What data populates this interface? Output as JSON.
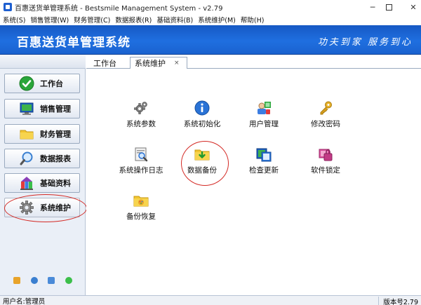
{
  "window": {
    "title": "百惠送货单管理系统 - Bestsmile Management System - v2.79",
    "minimize_glyph": "─",
    "close_glyph": "✕"
  },
  "menu": [
    "系统(S)",
    "销售管理(W)",
    "财务管理(C)",
    "数据报表(R)",
    "基础资料(B)",
    "系统维护(M)",
    "帮助(H)"
  ],
  "banner": {
    "app_name": "百惠送货单管理系统",
    "slogan": "功夫到家 服务到心"
  },
  "sidebar": {
    "items": [
      {
        "label": "工作台",
        "icon": "check-circle-icon"
      },
      {
        "label": "销售管理",
        "icon": "monitor-icon"
      },
      {
        "label": "财务管理",
        "icon": "folder-icon"
      },
      {
        "label": "数据报表",
        "icon": "magnifier-icon"
      },
      {
        "label": "基础资料",
        "icon": "building-blocks-icon"
      },
      {
        "label": "系统维护",
        "icon": "gear-icon"
      }
    ],
    "active_index": 5,
    "bottom_icons": [
      "note-icon",
      "clock-icon",
      "screen-icon",
      "refresh-icon"
    ]
  },
  "tabs": {
    "items": [
      {
        "label": "工作台"
      },
      {
        "label": "系统维护"
      }
    ],
    "active_index": 1,
    "close_glyph": "×"
  },
  "tools": [
    {
      "label": "系统参数",
      "icon": "gears-icon"
    },
    {
      "label": "系统初始化",
      "icon": "info-icon"
    },
    {
      "label": "用户管理",
      "icon": "users-icon"
    },
    {
      "label": "修改密码",
      "icon": "key-icon"
    },
    {
      "label": "系统操作日志",
      "icon": "log-search-icon"
    },
    {
      "label": "数据备份",
      "icon": "folder-download-icon"
    },
    {
      "label": "检查更新",
      "icon": "update-icon"
    },
    {
      "label": "软件锁定",
      "icon": "lock-icon"
    },
    {
      "label": "备份恢复",
      "icon": "folder-restore-icon"
    }
  ],
  "highlighted": [
    "数据备份",
    "系统维护"
  ],
  "status": {
    "user": "用户名:管理员",
    "version": "版本号2.79"
  },
  "colors": {
    "banner": "#1f6fe0",
    "highlight_ring": "#d42a25"
  }
}
